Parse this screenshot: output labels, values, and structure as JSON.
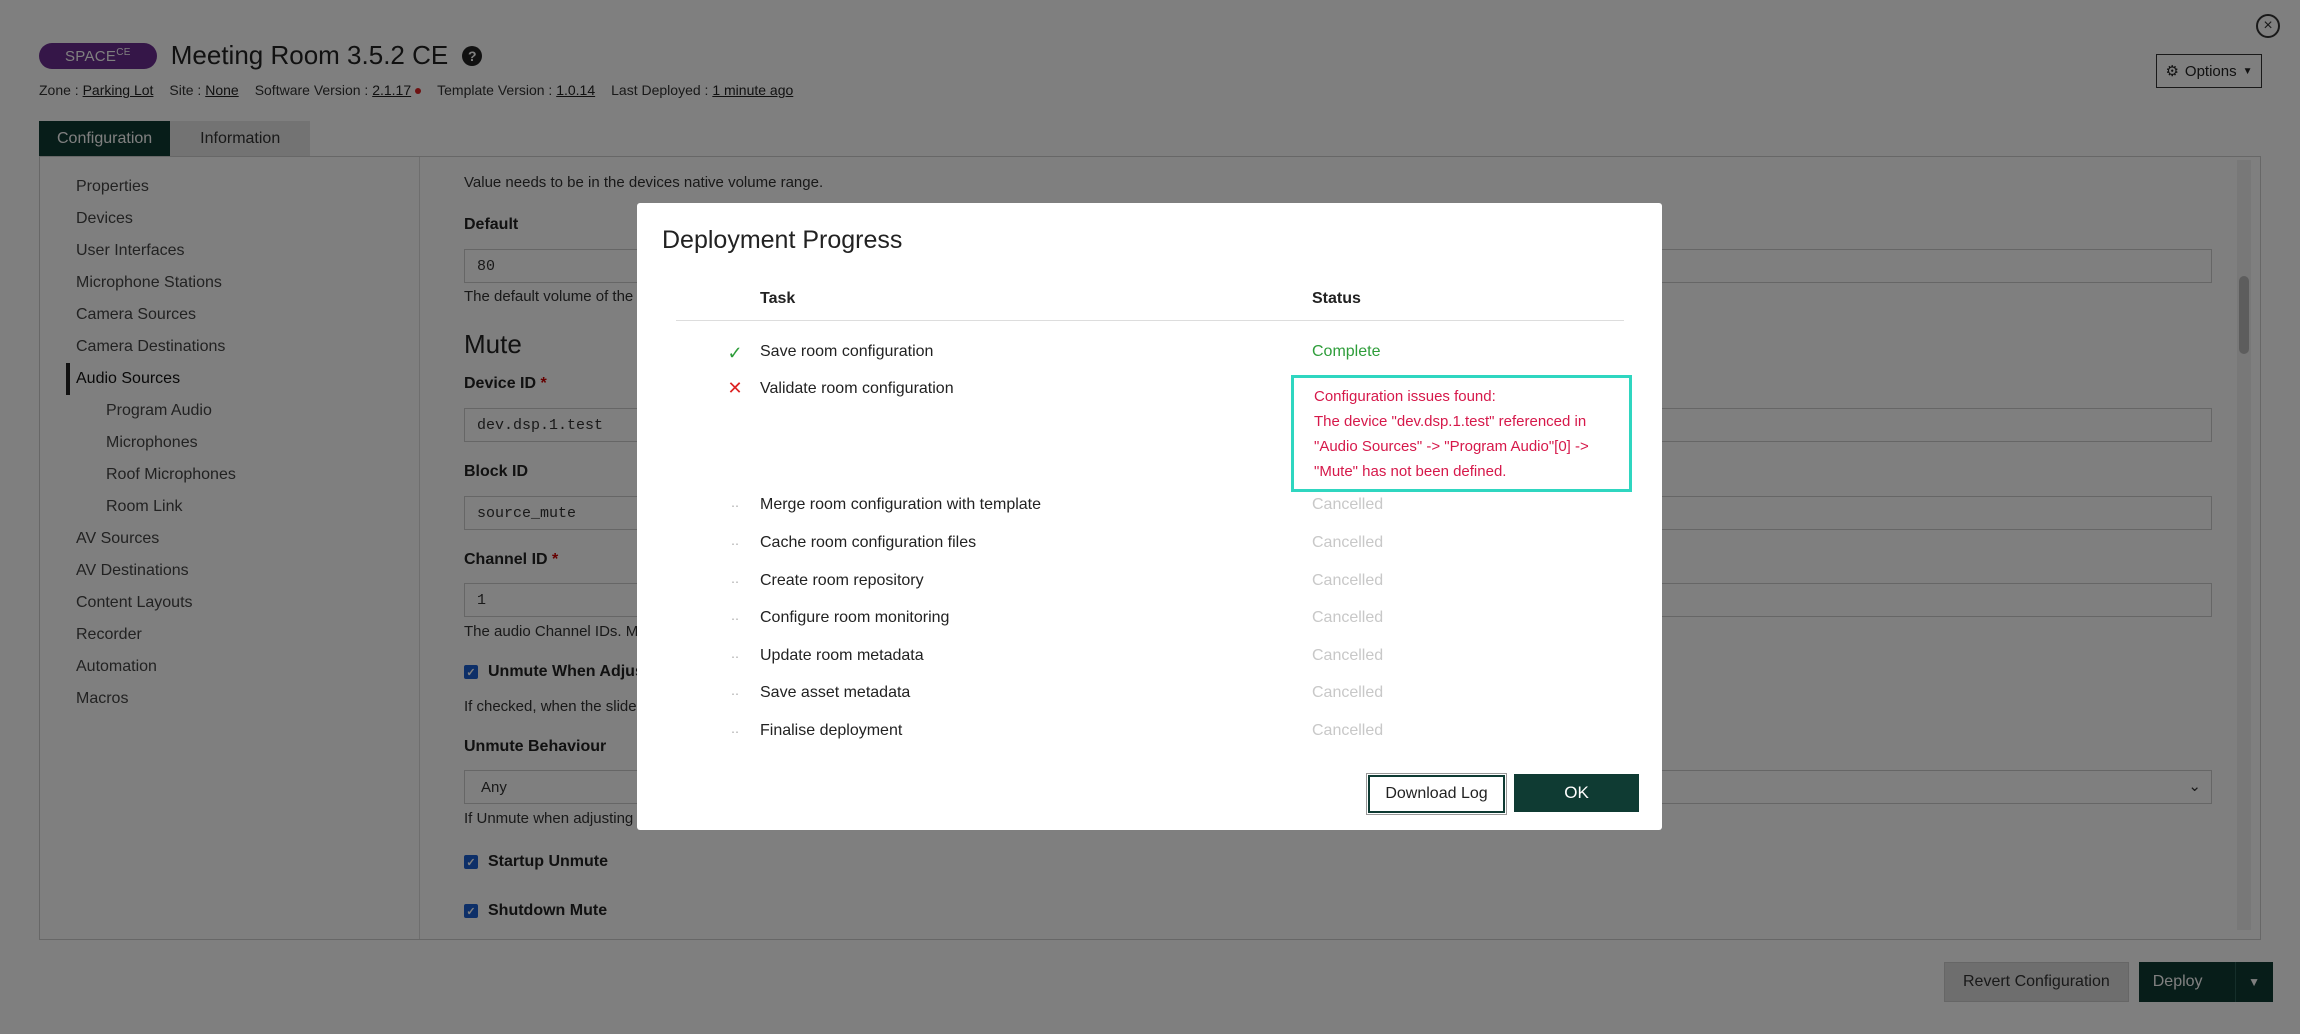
{
  "header": {
    "badge": "SPACE",
    "badge_sup": "CE",
    "room_title": "Meeting Room 3.5.2 CE",
    "meta": {
      "zone_label": "Zone :",
      "zone_value": "Parking Lot",
      "site_label": "Site :",
      "site_value": "None",
      "software_label": "Software Version :",
      "software_value": "2.1.17",
      "template_label": "Template Version :",
      "template_value": "1.0.14",
      "deployed_label": "Last Deployed :",
      "deployed_value": "1 minute ago"
    },
    "options_label": "Options"
  },
  "tabs": [
    {
      "label": "Configuration",
      "active": true
    },
    {
      "label": "Information",
      "active": false
    }
  ],
  "sidebar": {
    "items": [
      {
        "label": "Properties"
      },
      {
        "label": "Devices"
      },
      {
        "label": "User Interfaces"
      },
      {
        "label": "Microphone Stations"
      },
      {
        "label": "Camera Sources"
      },
      {
        "label": "Camera Destinations"
      },
      {
        "label": "Audio Sources",
        "active": true
      },
      {
        "label": "Program Audio",
        "sub": true
      },
      {
        "label": "Microphones",
        "sub": true
      },
      {
        "label": "Roof Microphones",
        "sub": true
      },
      {
        "label": "Room Link",
        "sub": true
      },
      {
        "label": "AV Sources"
      },
      {
        "label": "AV Destinations"
      },
      {
        "label": "Content Layouts"
      },
      {
        "label": "Recorder"
      },
      {
        "label": "Automation"
      },
      {
        "label": "Macros"
      }
    ]
  },
  "content": {
    "volume_help": "Value needs to be in the devices native volume range.",
    "default_label": "Default",
    "default_value": "80",
    "default_help": "The default volume of the",
    "mute_heading": "Mute",
    "device_id_label": "Device ID",
    "device_id_value": "dev.dsp.1.test",
    "block_id_label": "Block ID",
    "block_id_value": "source_mute",
    "channel_id_label": "Channel ID",
    "channel_id_value": "1",
    "channel_help": "The audio Channel IDs. Mu",
    "unmute_adjust_label": "Unmute When Adjusti",
    "unmute_adjust_help": "If checked, when the slider",
    "unmute_behaviour_label": "Unmute Behaviour",
    "unmute_behaviour_value": "Any",
    "unmute_behaviour_help": "If Unmute when adjusting",
    "startup_unmute_label": "Startup Unmute",
    "shutdown_mute_label": "Shutdown Mute",
    "required_mark": "*"
  },
  "footer": {
    "revert_label": "Revert Configuration",
    "deploy_label": "Deploy"
  },
  "modal": {
    "title": "Deployment Progress",
    "col_task": "Task",
    "col_status": "Status",
    "tasks": [
      {
        "task": "Save room configuration",
        "status": "Complete",
        "state": "complete"
      },
      {
        "task": "Validate room configuration",
        "status": "",
        "state": "failed"
      },
      {
        "task": "Merge room configuration with template",
        "status": "Cancelled",
        "state": "cancelled"
      },
      {
        "task": "Cache room configuration files",
        "status": "Cancelled",
        "state": "cancelled"
      },
      {
        "task": "Create room repository",
        "status": "Cancelled",
        "state": "cancelled"
      },
      {
        "task": "Configure room monitoring",
        "status": "Cancelled",
        "state": "cancelled"
      },
      {
        "task": "Update room metadata",
        "status": "Cancelled",
        "state": "cancelled"
      },
      {
        "task": "Save asset metadata",
        "status": "Cancelled",
        "state": "cancelled"
      },
      {
        "task": "Finalise deployment",
        "status": "Cancelled",
        "state": "cancelled"
      }
    ],
    "error_lines": [
      "Configuration issues found:",
      "The device \"dev.dsp.1.test\" referenced in",
      "\"Audio Sources\" -> \"Program Audio\"[0] ->",
      "\"Mute\" has not been defined."
    ],
    "download_label": "Download Log",
    "ok_label": "OK"
  },
  "colors": {
    "brand_dark": "#0f3b33",
    "badge_purple": "#6b2c91",
    "success": "#2e9d3a",
    "error": "#d6184a",
    "highlight": "#2fd6c0"
  }
}
